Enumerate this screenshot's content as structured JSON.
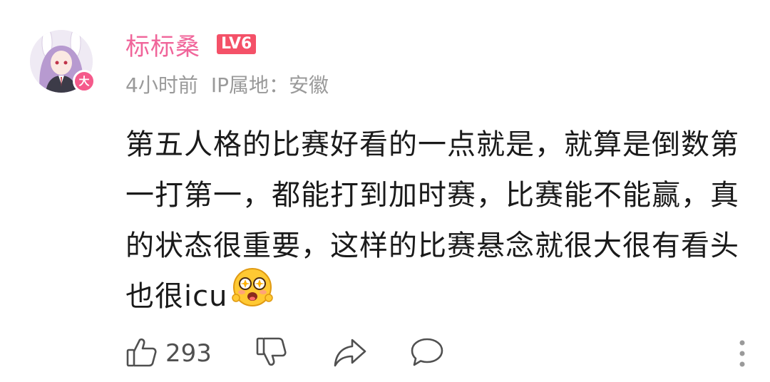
{
  "user": {
    "name": "标标桑",
    "level": "LV6",
    "avatar_badge": "大"
  },
  "meta": {
    "time": "4小时前",
    "ip_location": "IP属地：安徽"
  },
  "comment": {
    "text": "第五人格的比赛好看的一点就是，就算是倒数第一打第一，都能打到加时赛，比赛能不能赢，真的状态很重要，这样的比赛悬念就很大很有看头也很icu",
    "emoji": "starry-eyed-emoji"
  },
  "actions": {
    "like_count": "293",
    "icons": [
      "thumbs-up-icon",
      "thumbs-down-icon",
      "share-icon",
      "reply-icon",
      "more-icon"
    ]
  },
  "colors": {
    "username": "#f0659a",
    "level_badge": "#f45168",
    "meta_text": "#9a9a9a",
    "body_text": "#1a1a1a",
    "icon": "#505050"
  }
}
